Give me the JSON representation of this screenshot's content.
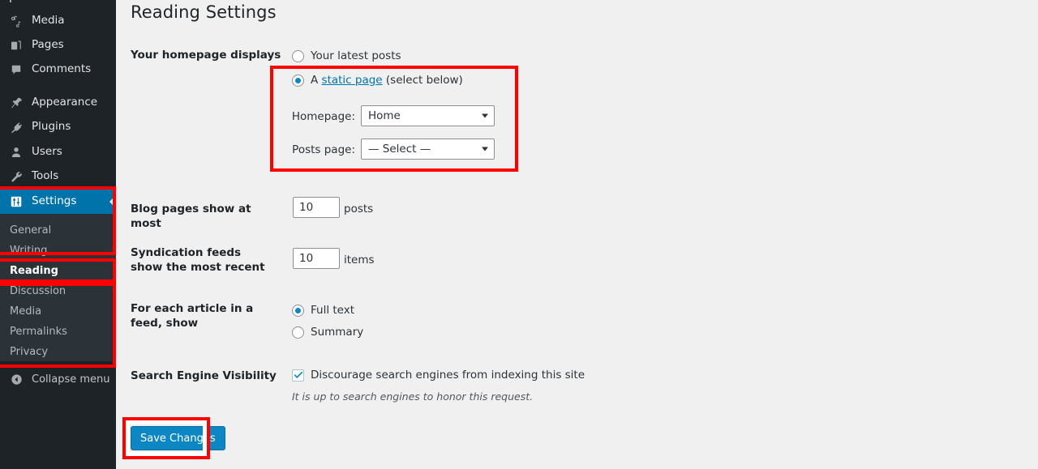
{
  "sidebar": {
    "items": [
      {
        "label": "Media",
        "icon": "media-icon"
      },
      {
        "label": "Pages",
        "icon": "pages-icon"
      },
      {
        "label": "Comments",
        "icon": "comments-icon"
      },
      {
        "label": "Appearance",
        "icon": "appearance-pushpin-icon"
      },
      {
        "label": "Plugins",
        "icon": "plugins-plug-icon"
      },
      {
        "label": "Users",
        "icon": "users-person-icon"
      },
      {
        "label": "Tools",
        "icon": "tools-wrench-icon"
      },
      {
        "label": "Settings",
        "icon": "settings-sliders-icon"
      }
    ],
    "current_item": "Settings",
    "submenu": [
      {
        "label": "General"
      },
      {
        "label": "Writing"
      },
      {
        "label": "Reading"
      },
      {
        "label": "Discussion"
      },
      {
        "label": "Media"
      },
      {
        "label": "Permalinks"
      },
      {
        "label": "Privacy"
      }
    ],
    "active_submenu": "Reading",
    "collapse": {
      "label": "Collapse menu",
      "icon": "collapse-left-arrow-icon"
    }
  },
  "page": {
    "title": "Reading Settings"
  },
  "homepage_displays": {
    "label": "Your homepage displays",
    "option_latest": "Your latest posts",
    "option_static_prefix": "A ",
    "option_static_link": "static page",
    "option_static_suffix": " (select below)",
    "selected": "static",
    "homepage_label": "Homepage:",
    "homepage_value": "Home",
    "posts_page_label": "Posts page:",
    "posts_page_value": "— Select —"
  },
  "blog_pages": {
    "label": "Blog pages show at most",
    "value": "10",
    "unit": "posts"
  },
  "syndication": {
    "label": "Syndication feeds show the most recent",
    "value": "10",
    "unit": "items"
  },
  "feed_article": {
    "label": "For each article in a feed, show",
    "option_full": "Full text",
    "option_summary": "Summary",
    "selected": "full"
  },
  "search_visibility": {
    "label": "Search Engine Visibility",
    "checkbox_label": "Discourage search engines from indexing this site",
    "checked": true,
    "note": "It is up to search engines to honor this request."
  },
  "actions": {
    "save_label": "Save Changes"
  },
  "colors": {
    "sidebar_bg": "#1d2327",
    "submenu_bg": "#2c3338",
    "accent_blue": "#0073aa",
    "button_blue": "#0d87c4",
    "annotation_red": "#fe0000",
    "content_bg": "#f0f0f1",
    "link": "#0073aa"
  }
}
